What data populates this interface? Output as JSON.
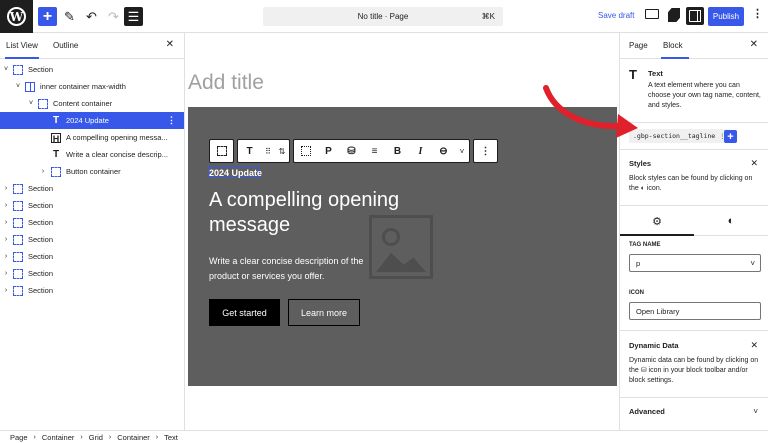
{
  "topbar": {
    "logo": "W",
    "document_title": "No title · Page",
    "shortcut": "⌘K",
    "save_draft": "Save draft",
    "publish": "Publish"
  },
  "list_panel": {
    "tabs": [
      "List View",
      "Outline"
    ],
    "items": [
      {
        "label": "Section",
        "icon": "section-icon",
        "chevron": "˅",
        "selected": false
      },
      {
        "label": "inner container max-width",
        "icon": "grid-icon",
        "chevron": "˅",
        "selected": false
      },
      {
        "label": "Content container",
        "icon": "section-icon",
        "chevron": "˅",
        "selected": false
      },
      {
        "label": "2024 Update",
        "icon": "text-icon",
        "chevron": "",
        "selected": true
      },
      {
        "label": "A compelling opening messa...",
        "icon": "heading-icon",
        "chevron": "",
        "selected": false
      },
      {
        "label": "Write a clear concise descrip...",
        "icon": "text-icon",
        "chevron": "",
        "selected": false
      },
      {
        "label": "Button container",
        "icon": "section-icon",
        "chevron": "›",
        "selected": false
      },
      {
        "label": "Section",
        "icon": "section-icon",
        "chevron": "›",
        "selected": false
      },
      {
        "label": "Section",
        "icon": "section-icon",
        "chevron": "›",
        "selected": false
      },
      {
        "label": "Section",
        "icon": "section-icon",
        "chevron": "›",
        "selected": false
      },
      {
        "label": "Section",
        "icon": "section-icon",
        "chevron": "›",
        "selected": false
      },
      {
        "label": "Section",
        "icon": "section-icon",
        "chevron": "›",
        "selected": false
      },
      {
        "label": "Section",
        "icon": "section-icon",
        "chevron": "›",
        "selected": false
      },
      {
        "label": "Section",
        "icon": "section-icon",
        "chevron": "›",
        "selected": false
      }
    ]
  },
  "canvas": {
    "add_title_placeholder": "Add title",
    "tagline": "2024 Update",
    "heading": "A compelling opening message",
    "description": "Write a clear concise description of the product or services you offer.",
    "primary_button": "Get started",
    "secondary_button": "Learn more",
    "toolbar": {
      "paragraph_label": "P",
      "bold_label": "B",
      "italic_label": "I"
    }
  },
  "settings_panel": {
    "tabs": [
      "Page",
      "Block"
    ],
    "block_name": "Text",
    "block_description": "A text element where you can choose your own tag name, content, and styles.",
    "class_chip": ".gbp-section__tagline",
    "styles_title": "Styles",
    "styles_text_before": "Block styles can be found by clicking on the",
    "styles_text_after": "icon.",
    "tag_name_label": "TAG NAME",
    "tag_name_value": "p",
    "icon_label": "ICON",
    "icon_value": "Open Library",
    "dynamic_title": "Dynamic Data",
    "dynamic_text_before": "Dynamic data can be found by clicking on the",
    "dynamic_text_after": "icon in your block toolbar and/or block settings.",
    "advanced_title": "Advanced"
  },
  "breadcrumb": [
    "Page",
    "Container",
    "Grid",
    "Container",
    "Text"
  ],
  "colors": {
    "accent": "#3858e9",
    "hero_bg": "#5e5e5e",
    "annotation_arrow": "#e0202a"
  }
}
